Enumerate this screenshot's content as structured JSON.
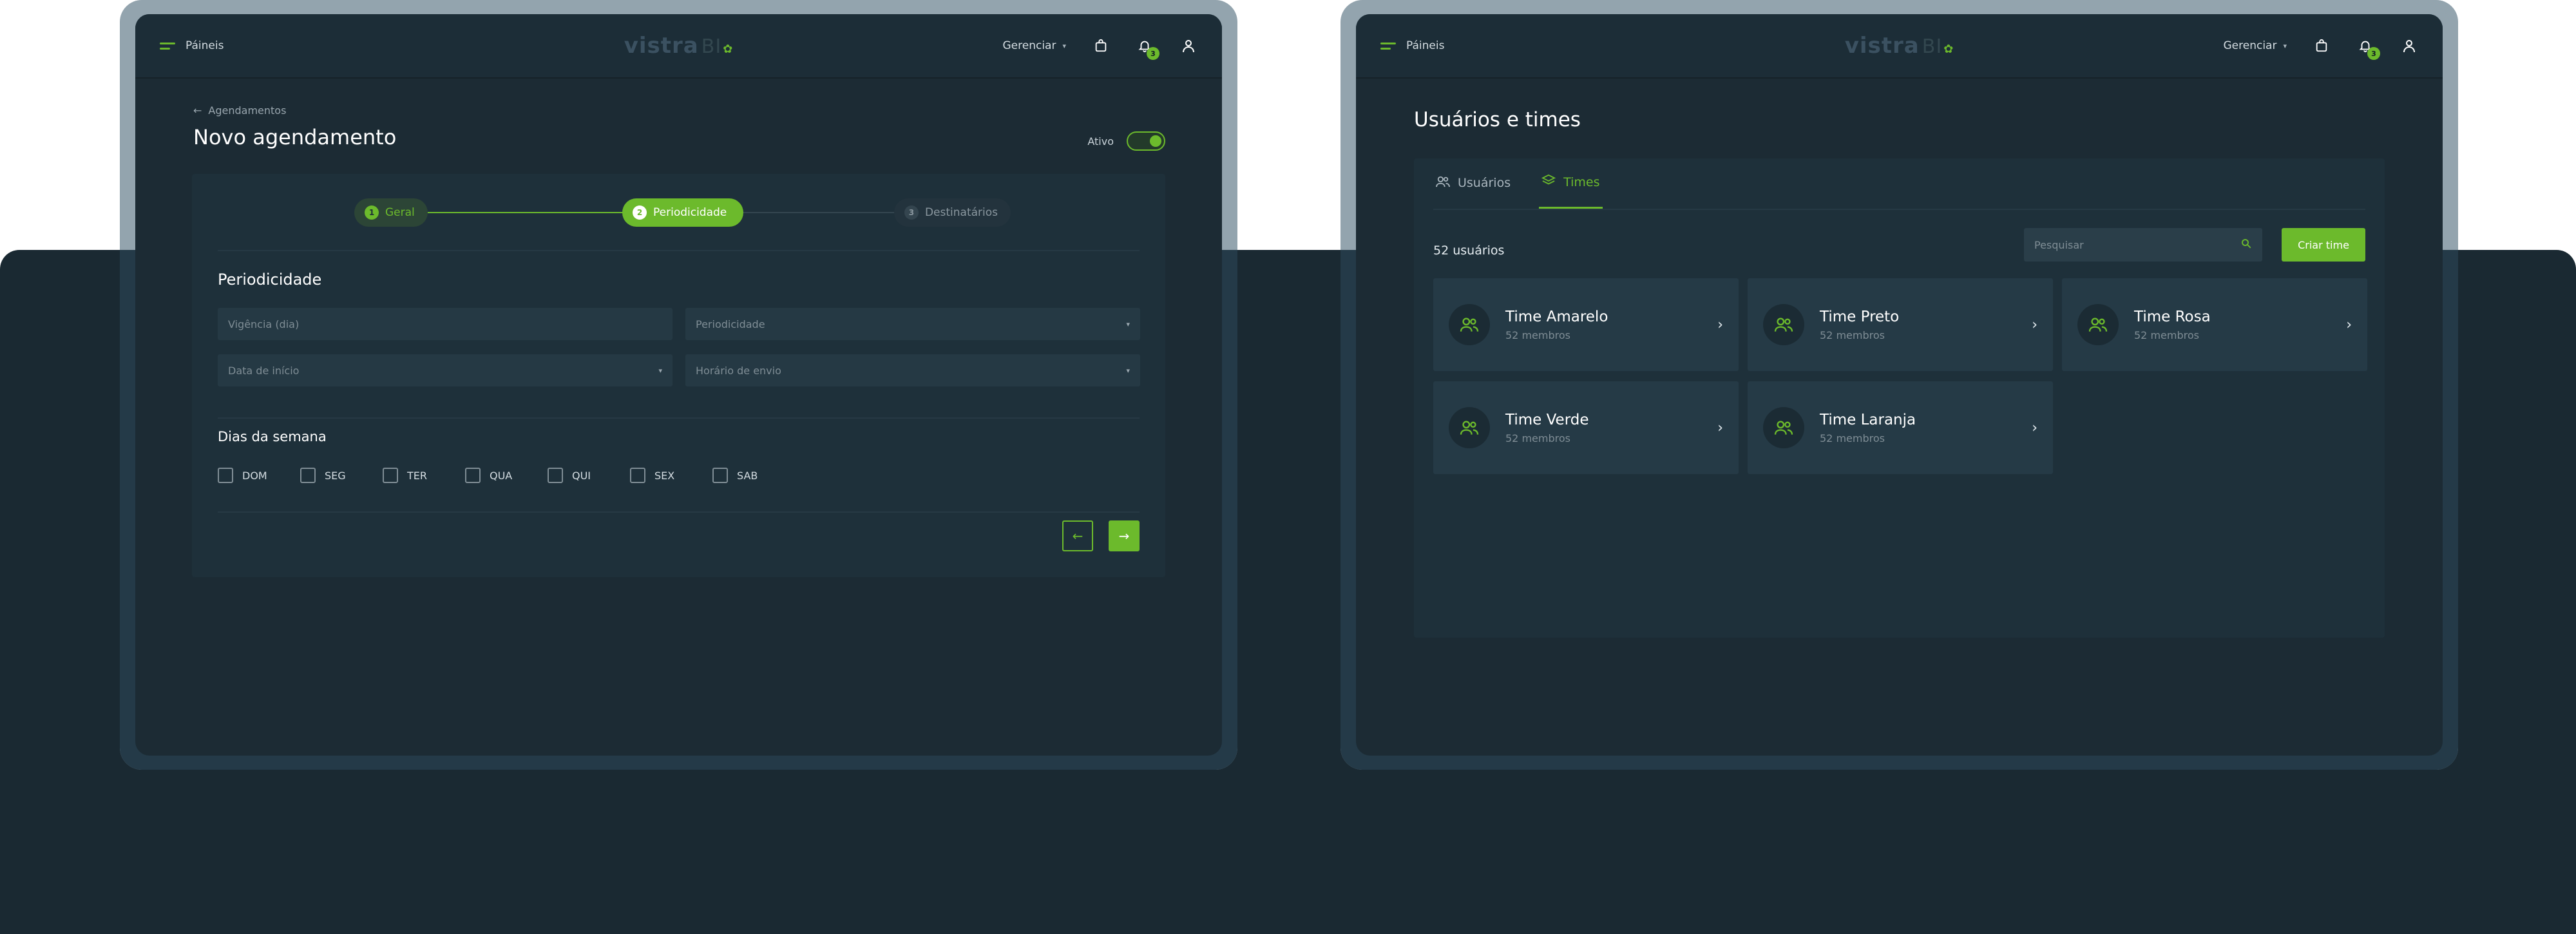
{
  "common": {
    "menu_label": "Páineis",
    "logo_text": "vistra",
    "logo_suffix": "BI",
    "manage_label": "Gerenciar",
    "notification_count": "3",
    "accent": "#6cba2c"
  },
  "left": {
    "breadcrumb": "Agendamentos",
    "title": "Novo agendamento",
    "active_label": "Ativo",
    "steps": [
      {
        "num": "1",
        "label": "Geral"
      },
      {
        "num": "2",
        "label": "Periodicidade"
      },
      {
        "num": "3",
        "label": "Destinatários"
      }
    ],
    "section_periodicity": "Periodicidade",
    "fields": {
      "validity_placeholder": "Vigência (dia)",
      "periodicity_placeholder": "Periodicidade",
      "start_date_placeholder": "Data de início",
      "send_time_placeholder": "Horário de envio"
    },
    "section_weekdays": "Dias da semana",
    "days": [
      "DOM",
      "SEG",
      "TER",
      "QUA",
      "QUI",
      "SEX",
      "SAB"
    ]
  },
  "right": {
    "title": "Usuários e times",
    "tabs": [
      {
        "label": "Usuários",
        "icon": "users-icon"
      },
      {
        "label": "Times",
        "icon": "layers-icon"
      }
    ],
    "count": "52 usuários",
    "search_placeholder": "Pesquisar",
    "create_button": "Criar time",
    "teams": [
      {
        "name": "Time Amarelo",
        "members": "52 membros"
      },
      {
        "name": "Time Preto",
        "members": "52 membros"
      },
      {
        "name": "Time Rosa",
        "members": "52 membros"
      },
      {
        "name": "Time Verde",
        "members": "52 membros"
      },
      {
        "name": "Time Laranja",
        "members": "52 membros"
      }
    ]
  }
}
